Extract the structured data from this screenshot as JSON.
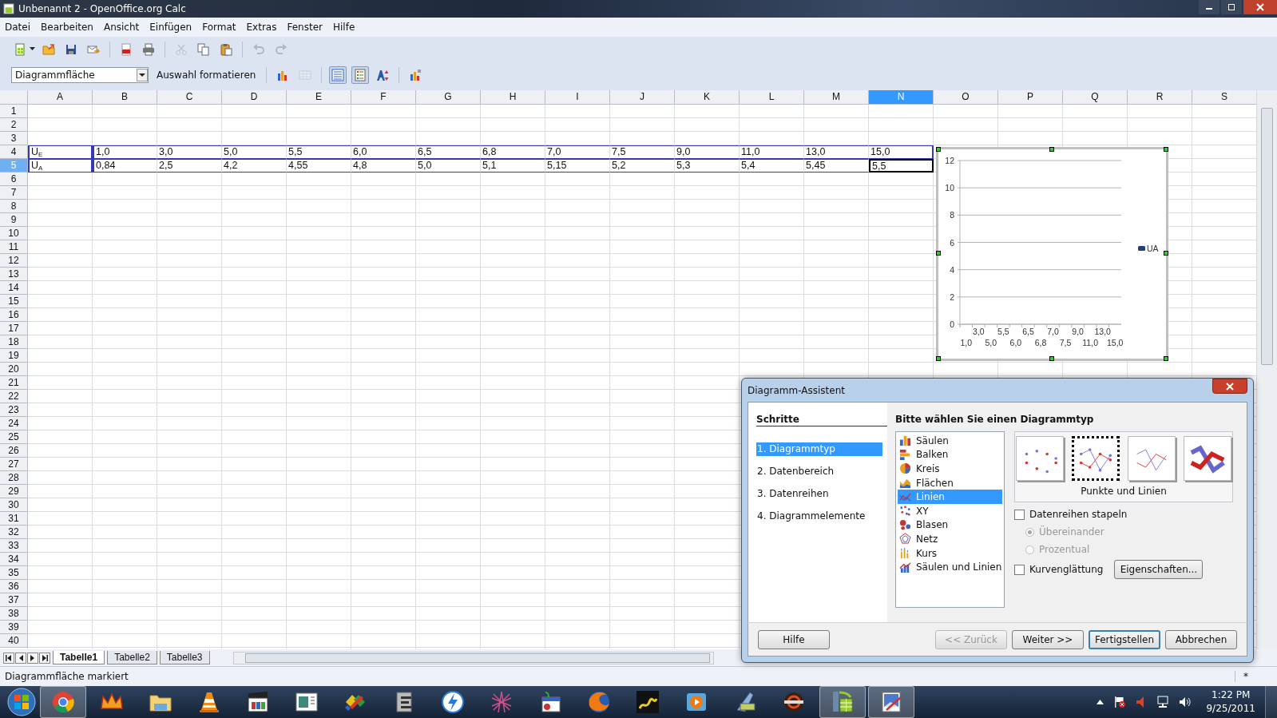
{
  "window": {
    "title": "Unbenannt 2 - OpenOffice.org Calc"
  },
  "menu": [
    "Datei",
    "Bearbeiten",
    "Ansicht",
    "Einfügen",
    "Format",
    "Extras",
    "Fenster",
    "Hilfe"
  ],
  "toolbar": {
    "buttons": [
      {
        "disabled": false
      },
      {
        "disabled": false
      },
      {
        "disabled": false
      },
      {
        "disabled": false
      },
      {
        "disabled": false
      },
      {
        "disabled": false
      },
      {
        "disabled": true
      },
      {
        "disabled": false
      },
      {
        "disabled": false
      },
      {
        "disabled": true
      },
      {
        "disabled": true
      }
    ]
  },
  "chart_toolbar": {
    "element": "Diagrammfläche",
    "format_button": "Auswahl formatieren",
    "tools": [
      {
        "on": false,
        "disabled": false
      },
      {
        "on": false,
        "disabled": true
      },
      {
        "on": true,
        "disabled": false
      },
      {
        "on": true,
        "disabled": false
      },
      {
        "on": false,
        "disabled": false
      },
      {
        "on": false,
        "disabled": false
      }
    ]
  },
  "sheet": {
    "columns": [
      {
        "label": "A",
        "selected": false
      },
      {
        "label": "B",
        "selected": false
      },
      {
        "label": "C",
        "selected": false
      },
      {
        "label": "D",
        "selected": false
      },
      {
        "label": "E",
        "selected": false
      },
      {
        "label": "F",
        "selected": false
      },
      {
        "label": "G",
        "selected": false
      },
      {
        "label": "H",
        "selected": false
      },
      {
        "label": "I",
        "selected": false
      },
      {
        "label": "J",
        "selected": false
      },
      {
        "label": "K",
        "selected": false
      },
      {
        "label": "L",
        "selected": false
      },
      {
        "label": "M",
        "selected": false
      },
      {
        "label": "N",
        "selected": true
      },
      {
        "label": "O",
        "selected": false
      },
      {
        "label": "P",
        "selected": false
      },
      {
        "label": "Q",
        "selected": false
      },
      {
        "label": "R",
        "selected": false
      },
      {
        "label": "S",
        "selected": false
      }
    ],
    "rows": [
      {
        "label": "1",
        "selected": false
      },
      {
        "label": "2",
        "selected": false
      },
      {
        "label": "3",
        "selected": false
      },
      {
        "label": "4",
        "selected": false,
        "cells": [
          {
            "text": "U$_{E}$",
            "active": false
          },
          {
            "text": "1,0",
            "active": false
          },
          {
            "text": "3,0",
            "active": false
          },
          {
            "text": "5,0",
            "active": false
          },
          {
            "text": "5,5",
            "active": false
          },
          {
            "text": "6,0",
            "active": false
          },
          {
            "text": "6,5",
            "active": false
          },
          {
            "text": "6,8",
            "active": false
          },
          {
            "text": "7,0",
            "active": false
          },
          {
            "text": "7,5",
            "active": false
          },
          {
            "text": "9,0",
            "active": false
          },
          {
            "text": "11,0",
            "active": false
          },
          {
            "text": "13,0",
            "active": false
          },
          {
            "text": "15,0",
            "active": false
          }
        ]
      },
      {
        "label": "5",
        "selected": true,
        "cells": [
          {
            "text": "U$_{A}$",
            "active": false
          },
          {
            "text": "0,84",
            "active": false
          },
          {
            "text": "2,5",
            "active": false
          },
          {
            "text": "4,2",
            "active": false
          },
          {
            "text": "4,55",
            "active": false
          },
          {
            "text": "4,8",
            "active": false
          },
          {
            "text": "5,0",
            "active": false
          },
          {
            "text": "5,1",
            "active": false
          },
          {
            "text": "5,15",
            "active": false
          },
          {
            "text": "5,2",
            "active": false
          },
          {
            "text": "5,3",
            "active": false
          },
          {
            "text": "5,4",
            "active": false
          },
          {
            "text": "5,45",
            "active": false
          },
          {
            "text": "5,5",
            "active": true
          }
        ]
      },
      {
        "label": "6",
        "selected": false
      },
      {
        "label": "7",
        "selected": false
      },
      {
        "label": "8",
        "selected": false
      },
      {
        "label": "9",
        "selected": false
      },
      {
        "label": "10",
        "selected": false
      },
      {
        "label": "11",
        "selected": false
      },
      {
        "label": "12",
        "selected": false
      },
      {
        "label": "13",
        "selected": false
      },
      {
        "label": "14",
        "selected": false
      },
      {
        "label": "15",
        "selected": false
      },
      {
        "label": "16",
        "selected": false
      },
      {
        "label": "17",
        "selected": false
      },
      {
        "label": "18",
        "selected": false
      },
      {
        "label": "19",
        "selected": false
      },
      {
        "label": "20",
        "selected": false
      },
      {
        "label": "21",
        "selected": false
      },
      {
        "label": "22",
        "selected": false
      },
      {
        "label": "23",
        "selected": false
      },
      {
        "label": "24",
        "selected": false
      },
      {
        "label": "25",
        "selected": false
      },
      {
        "label": "26",
        "selected": false
      },
      {
        "label": "27",
        "selected": false
      },
      {
        "label": "28",
        "selected": false
      },
      {
        "label": "29",
        "selected": false
      },
      {
        "label": "30",
        "selected": false
      },
      {
        "label": "31",
        "selected": false
      },
      {
        "label": "32",
        "selected": false
      },
      {
        "label": "33",
        "selected": false
      },
      {
        "label": "34",
        "selected": false
      },
      {
        "label": "35",
        "selected": false
      },
      {
        "label": "36",
        "selected": false
      },
      {
        "label": "37",
        "selected": false
      },
      {
        "label": "38",
        "selected": false
      },
      {
        "label": "39",
        "selected": false
      },
      {
        "label": "40",
        "selected": false
      }
    ],
    "chart": {
      "chart_data": {
        "type": "line",
        "categories": [
          "1,0",
          "3,0",
          "5,0",
          "5,5",
          "6,0",
          "6,5",
          "6,8",
          "7,0",
          "7,5",
          "9,0",
          "11,0",
          "13,0",
          "15,0"
        ],
        "series": [
          {
            "name": "UA",
            "color": "#1f3f7f",
            "values": [
              null,
              null,
              null,
              null,
              null,
              null,
              null,
              null,
              null,
              null,
              null,
              null,
              null
            ]
          }
        ],
        "ylim": [
          0,
          12
        ],
        "yticks": [
          0,
          2,
          4,
          6,
          8,
          10,
          12
        ],
        "grid": true
      }
    }
  },
  "sheet_tabs": [
    {
      "label": "Tabelle1",
      "selected": true
    },
    {
      "label": "Tabelle2",
      "selected": false
    },
    {
      "label": "Tabelle3",
      "selected": false
    }
  ],
  "status_bar": {
    "message": "Diagrammfläche markiert",
    "indicator": "*"
  },
  "dialog": {
    "title": "Diagramm-Assistent",
    "steps_heading": "Schritte",
    "steps": [
      {
        "label": "1. Diagrammtyp",
        "selected": true
      },
      {
        "label": "2. Datenbereich",
        "selected": false
      },
      {
        "label": "3. Datenreihen",
        "selected": false
      },
      {
        "label": "4. Diagrammelemente",
        "selected": false
      }
    ],
    "heading": "Bitte wählen Sie einen Diagrammtyp",
    "chart_types": [
      {
        "label": "Säulen",
        "selected": false
      },
      {
        "label": "Balken",
        "selected": false
      },
      {
        "label": "Kreis",
        "selected": false
      },
      {
        "label": "Flächen",
        "selected": false
      },
      {
        "label": "Linien",
        "selected": true
      },
      {
        "label": "XY",
        "selected": false
      },
      {
        "label": "Blasen",
        "selected": false
      },
      {
        "label": "Netz",
        "selected": false
      },
      {
        "label": "Kurs",
        "selected": false
      },
      {
        "label": "Säulen und Linien",
        "selected": false
      }
    ],
    "variants": [
      {
        "selected": false
      },
      {
        "selected": true
      },
      {
        "selected": false
      },
      {
        "selected": false
      }
    ],
    "variant_label": "Punkte und Linien",
    "stack": {
      "label": "Datenreihen stapeln",
      "checked": false
    },
    "stack_modes": [
      {
        "label": "Übereinander",
        "selected": true,
        "disabled": true
      },
      {
        "label": "Prozentual",
        "selected": false,
        "disabled": true
      }
    ],
    "smoothing": {
      "label": "Kurvenglättung",
      "checked": false
    },
    "properties_button": "Eigenschaften...",
    "buttons": [
      {
        "label": "Hilfe",
        "disabled": false,
        "default": false
      },
      {
        "label": "<< Zurück",
        "disabled": true,
        "default": false
      },
      {
        "label": "Weiter >>",
        "disabled": false,
        "default": false
      },
      {
        "label": "Fertigstellen",
        "disabled": false,
        "default": true
      },
      {
        "label": "Abbrechen",
        "disabled": false,
        "default": false
      }
    ]
  },
  "taskbar": {
    "apps": [
      {
        "active": true
      },
      {
        "active": false
      },
      {
        "active": false
      },
      {
        "active": false
      },
      {
        "active": false
      },
      {
        "active": false
      },
      {
        "active": false
      },
      {
        "active": false
      },
      {
        "active": false
      },
      {
        "active": false
      },
      {
        "active": false
      },
      {
        "active": false
      },
      {
        "active": false
      },
      {
        "active": false
      },
      {
        "active": false
      },
      {
        "active": false
      },
      {
        "active": true
      },
      {
        "active": true
      }
    ],
    "time": "1:22 PM",
    "date": "9/25/2011"
  }
}
